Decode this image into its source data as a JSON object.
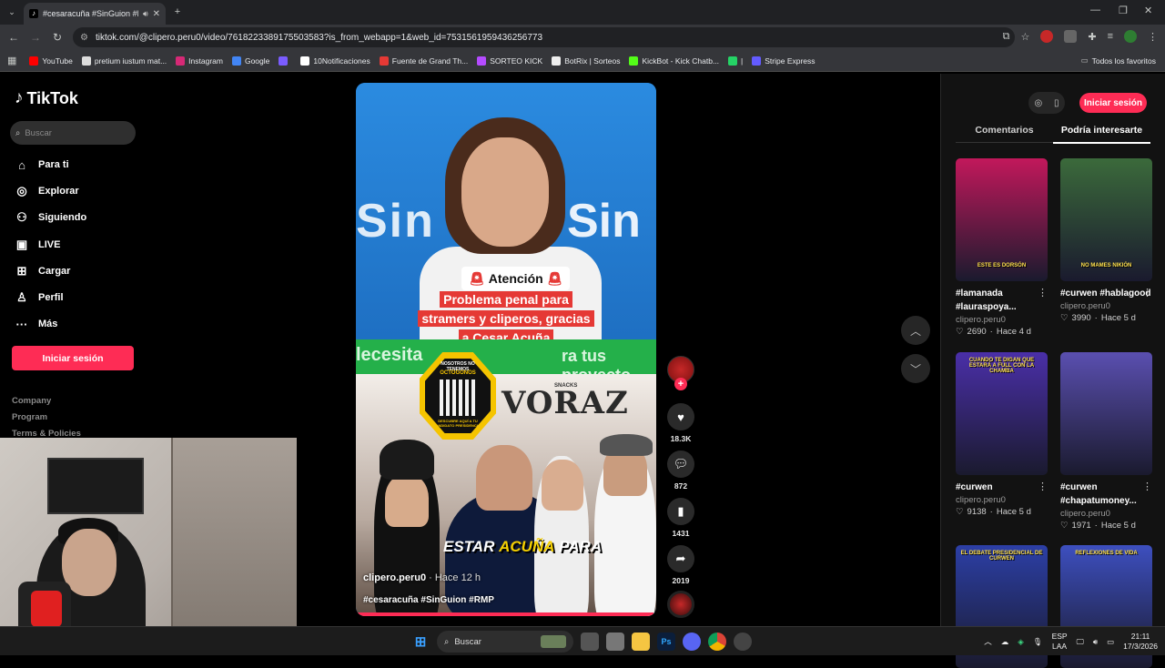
{
  "browser": {
    "tab_title": "#cesaracuña #SinGuion #RI",
    "url": "tiktok.com/@clipero.peru0/video/7618223389175503583?is_from_webapp=1&web_id=7531561959436256773",
    "bookmarks": [
      {
        "label": "YouTube",
        "color": "#ff0000"
      },
      {
        "label": "pretium iustum mat...",
        "color": "#dddddd"
      },
      {
        "label": "Instagram",
        "color": "#d62976"
      },
      {
        "label": "Google",
        "color": "#4285f4"
      },
      {
        "label": "",
        "color": "#7a5cff"
      },
      {
        "label": "10Notificaciones",
        "color": "#ffffff"
      },
      {
        "label": "Fuente de Grand Th...",
        "color": "#e53935"
      },
      {
        "label": "SORTEO KICK",
        "color": "#b44bff"
      },
      {
        "label": "BotRix | Sorteos",
        "color": "#eeeeee"
      },
      {
        "label": "KickBot - Kick Chatb...",
        "color": "#53fc18"
      },
      {
        "label": "|",
        "color": "#25d366"
      },
      {
        "label": "Stripe Express",
        "color": "#635bff"
      }
    ],
    "all_bookmarks": "Todos los favoritos"
  },
  "tiktok": {
    "logo": "TikTok",
    "search_placeholder": "Buscar",
    "nav": [
      "Para ti",
      "Explorar",
      "Siguiendo",
      "LIVE",
      "Cargar",
      "Perfil",
      "Más"
    ],
    "login": "Iniciar sesión",
    "footer": [
      "Company",
      "Program",
      "Terms & Policies"
    ]
  },
  "video": {
    "attention": "Atención",
    "caption": "Problema penal para stramers y cliperos, gracias a Cesar Acuña",
    "green_left": "lecesita",
    "green_right": "ra tus proyecto",
    "badge_top": "NOSOTROS NO TENEMOS",
    "badge_brand": "OCTOGONOS",
    "badge_bottom": "DESCUBRE AQUÍ A TU CANDIDATO PRESIDENCIAL",
    "snacks": "SNACKS",
    "brand": "VORAZ",
    "overlay_left": "ESTAR ",
    "overlay_hl": "ACUÑA",
    "overlay_right": " PARA",
    "author": "clipero.peru0",
    "time": " · Hace 12 h",
    "tags": "#cesaracuña #SinGuion #RMP",
    "progress": 0.99
  },
  "actions": {
    "likes": "18.3K",
    "comments": "872",
    "saves": "1431",
    "shares": "2019"
  },
  "right_panel": {
    "login": "Iniciar sesión",
    "tabs": [
      "Comentarios",
      "Podría interesarte"
    ],
    "cards": [
      {
        "title": "#lamanada #lauraspoya...",
        "author": "clipero.peru0",
        "likes": "2690",
        "time": "Hace 4 d",
        "thumb_caption": "ESTE ES DORSÓN",
        "bg": "#c2185b"
      },
      {
        "title": "#curwen #hablagood",
        "author": "clipero.peru0",
        "likes": "3990",
        "time": "Hace 5 d",
        "thumb_caption": "NO MAMES NIKIÓN",
        "bg": "#3b6a3b"
      },
      {
        "title": "#curwen",
        "author": "clipero.peru0",
        "likes": "9138",
        "time": "Hace 5 d",
        "thumb_caption": "CUANDO TE DIGAN QUE ESTARÁ A FULL CON LA CHAMBA",
        "bg": "#4a2fa8"
      },
      {
        "title": "#curwen #chapatumoney...",
        "author": "clipero.peru0",
        "likes": "1971",
        "time": "Hace 5 d",
        "thumb_caption": "",
        "bg": "#5a4fb0"
      },
      {
        "title": "",
        "author": "",
        "likes": "",
        "time": "",
        "thumb_caption": "EL DEBATE PRESIDENCIAL DE CURWEN",
        "bg": "#2c3fa6"
      },
      {
        "title": "",
        "author": "",
        "likes": "",
        "time": "",
        "thumb_caption": "REFLEXIONES DE VIDA",
        "bg": "#3d4fbf"
      }
    ]
  },
  "taskbar": {
    "search": "Buscar",
    "lang1": "ESP",
    "lang2": "LAA",
    "time": "21:11",
    "date": "17/3/2026"
  }
}
